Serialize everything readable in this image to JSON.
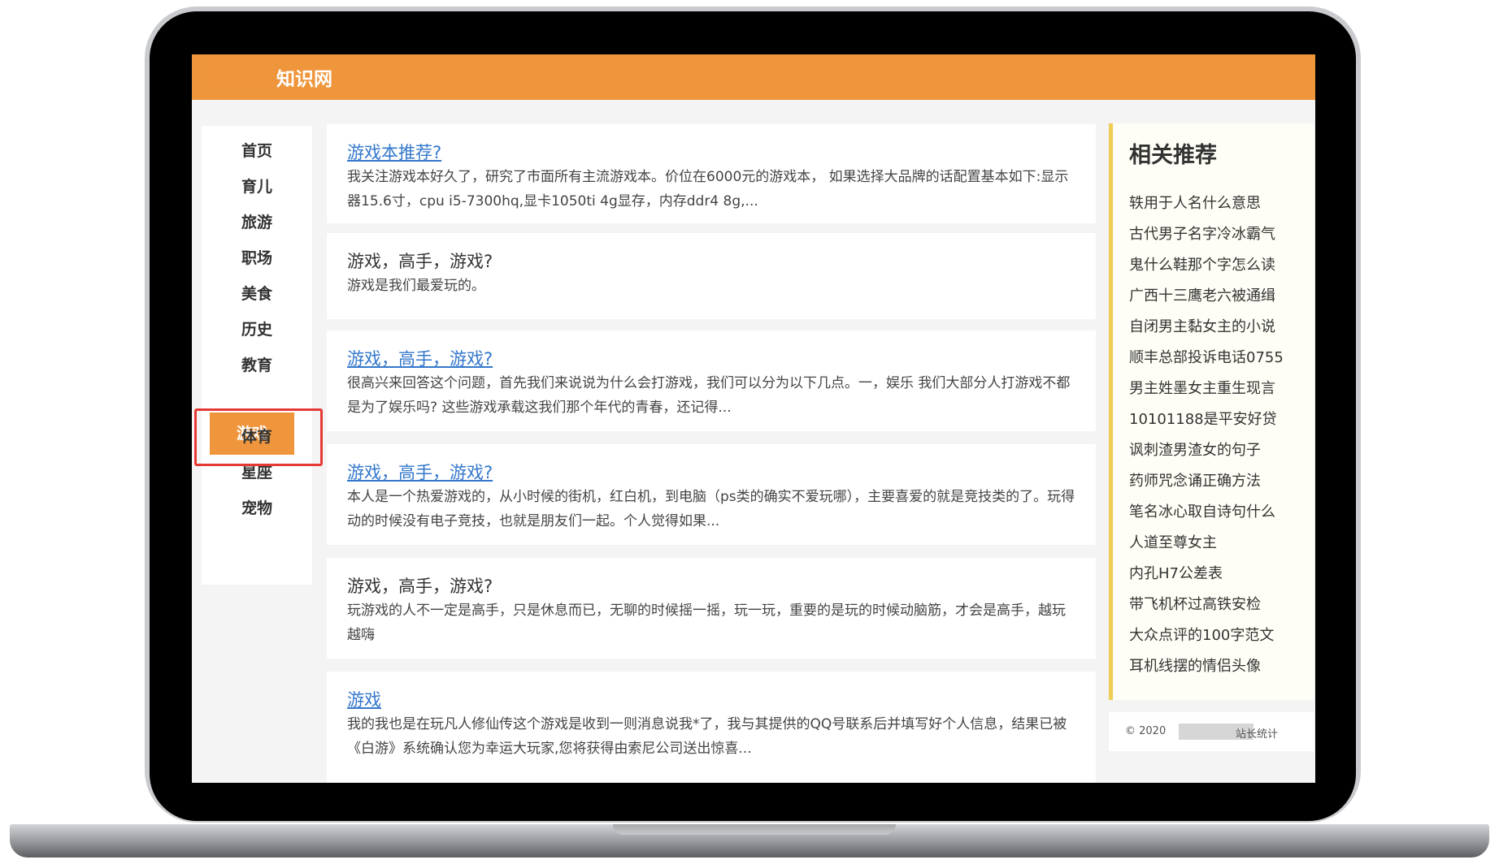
{
  "site": {
    "title": "知识网"
  },
  "nav": {
    "items": [
      {
        "label": "首页",
        "active": false
      },
      {
        "label": "育儿",
        "active": false
      },
      {
        "label": "旅游",
        "active": false
      },
      {
        "label": "职场",
        "active": false
      },
      {
        "label": "美食",
        "active": false
      },
      {
        "label": "历史",
        "active": false
      },
      {
        "label": "教育",
        "active": false
      },
      {
        "label": "游戏",
        "active": true
      },
      {
        "label": "体育",
        "active": false
      },
      {
        "label": "星座",
        "active": false
      },
      {
        "label": "宠物",
        "active": false
      }
    ]
  },
  "articles": [
    {
      "title": "游戏本推荐? ",
      "is_link": true,
      "excerpt": "我关注游戏本好久了，研究了市面所有主流游戏本。价位在6000元的游戏本， 如果选择大品牌的话配置基本如下:显示器15.6寸，cpu i5-7300hq,显卡1050ti 4g显存，内存ddr4 8g,..."
    },
    {
      "title": "游戏，高手，游戏?",
      "is_link": false,
      "excerpt": "游戏是我们最爱玩的。"
    },
    {
      "title": "游戏，高手，游戏? ",
      "is_link": true,
      "excerpt": "很高兴来回答这个问题，首先我们来说说为什么会打游戏，我们可以分为以下几点。一，娱乐 我们大部分人打游戏不都是为了娱乐吗? 这些游戏承载这我们那个年代的青春，还记得..."
    },
    {
      "title": "游戏，高手，游戏? ",
      "is_link": true,
      "excerpt": "本人是一个热爱游戏的，从小时候的街机，红白机，到电脑（ps类的确实不爱玩哪），主要喜爱的就是竞技类的了。玩得动的时候没有电子竞技，也就是朋友们一起。个人觉得如果..."
    },
    {
      "title": "游戏，高手，游戏?",
      "is_link": false,
      "excerpt": "玩游戏的人不一定是高手，只是休息而已，无聊的时候摇一摇，玩一玩，重要的是玩的时候动脑筋，才会是高手，越玩越嗨"
    },
    {
      "title": "游戏",
      "is_link": true,
      "excerpt": "我的我也是在玩凡人修仙传这个游戏是收到一则消息说我*了，我与其提供的QQ号联系后并填写好个人信息，结果已被《白游》系统确认您为幸运大玩家,您将获得由索尼公司送出惊喜..."
    }
  ],
  "recommend": {
    "title": "相关推荐",
    "items": [
      "轶用于人名什么意思",
      "古代男子名字冷冰霸气",
      "鬼什么鞋那个字怎么读",
      "广西十三鹰老六被通缉",
      "自闭男主黏女主的小说",
      "顺丰总部投诉电话0755",
      "男主姓墨女主重生现言",
      "10101188是平安好贷",
      "讽刺渣男渣女的句子",
      "药师咒念诵正确方法",
      "笔名冰心取自诗句什么",
      "人道至尊女主",
      "内孔H7公差表",
      "带飞机杯过高铁安检",
      "大众点评的100字范文",
      "耳机线摆的情侣头像"
    ]
  },
  "footer": {
    "copyright": "© 2020",
    "stats_label": "站长统计"
  },
  "colors": {
    "accent": "#ef963d",
    "link": "#3377cc",
    "highlight": "#e53935",
    "rec_border": "#f0cd55"
  }
}
